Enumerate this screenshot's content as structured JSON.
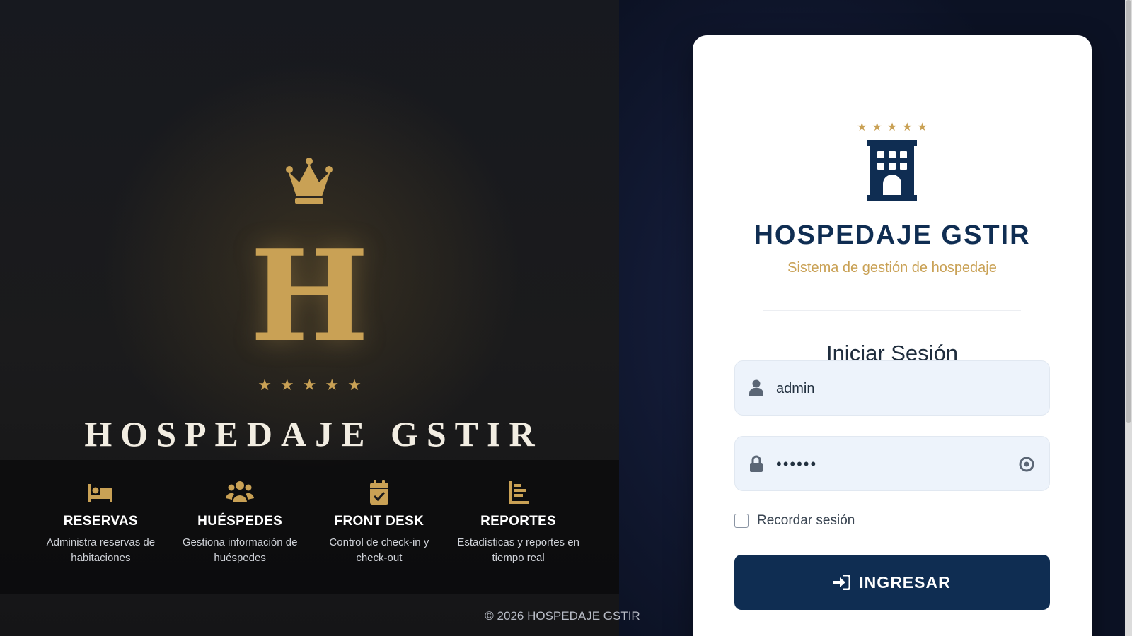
{
  "hero": {
    "initial": "H",
    "stars": "★★★★★",
    "title": "HOSPEDAJE GSTIR",
    "features": [
      {
        "icon": "bed-icon",
        "title": "RESERVAS",
        "desc_line1": "Administra reservas de",
        "desc_line2": "habitaciones"
      },
      {
        "icon": "users-icon",
        "title": "HUÉSPEDES",
        "desc_line1": "Gestiona información de",
        "desc_line2": "huéspedes"
      },
      {
        "icon": "calendar-check-icon",
        "title": "FRONT DESK",
        "desc_line1": "Control de check-in y",
        "desc_line2": "check-out"
      },
      {
        "icon": "chart-list-icon",
        "title": "REPORTES",
        "desc_line1": "Estadísticas y reportes en",
        "desc_line2": "tiempo real"
      }
    ]
  },
  "footer": {
    "text": "© 2026 HOSPEDAJE GSTIR"
  },
  "login": {
    "stars": "★★★★★",
    "title": "HOSPEDAJE GSTIR",
    "subtitle": "Sistema de gestión de hospedaje",
    "heading": "Iniciar Sesión",
    "username": {
      "value": "admin"
    },
    "password": {
      "value": "••••••"
    },
    "remember_label": "Recordar sesión",
    "remember_checked": false,
    "submit_label": "INGRESAR"
  },
  "colors": {
    "gold": "#c9a155",
    "navy": "#0f2d52",
    "input_bg": "#edf3fb"
  }
}
